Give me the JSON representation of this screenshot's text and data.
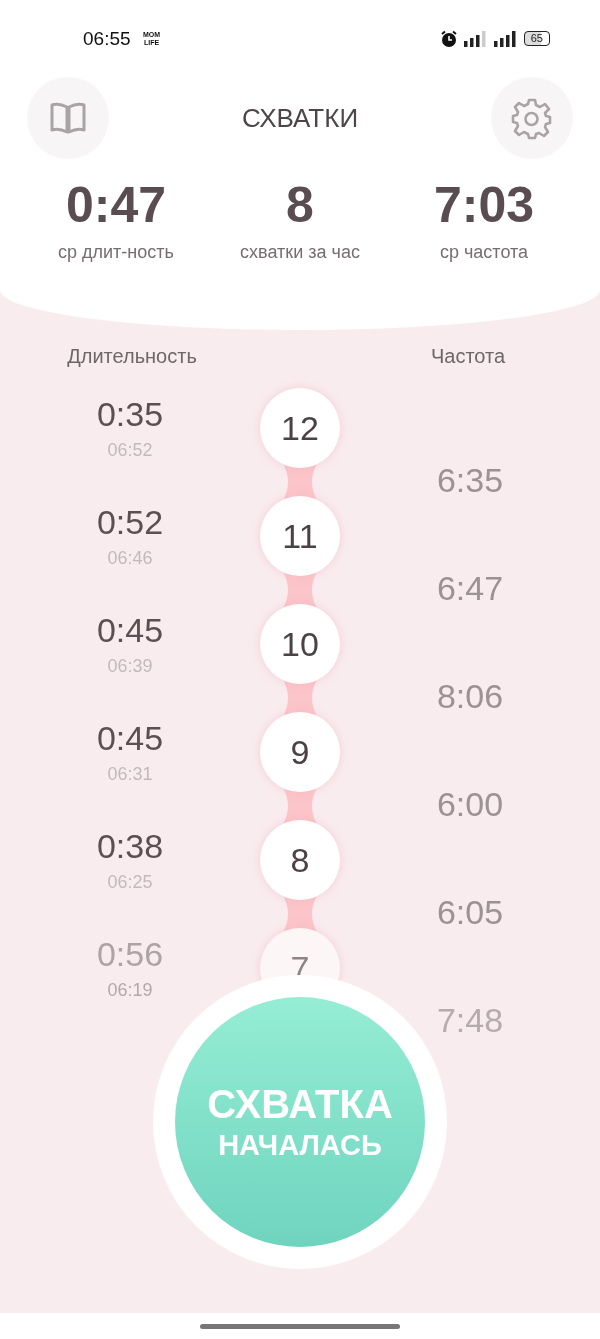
{
  "status_bar": {
    "time": "06:55",
    "app_badge": "MOM LIFE",
    "battery": "65"
  },
  "header": {
    "title": "СХВАТКИ"
  },
  "stats": [
    {
      "value": "0:47",
      "label": "ср длит-ность"
    },
    {
      "value": "8",
      "label": "схватки за час"
    },
    {
      "value": "7:03",
      "label": "ср частота"
    }
  ],
  "columns": {
    "duration": "Длительность",
    "frequency": "Частота"
  },
  "contractions": [
    {
      "number": "12",
      "duration": "0:35",
      "time": "06:52",
      "frequency": "6:35"
    },
    {
      "number": "11",
      "duration": "0:52",
      "time": "06:46",
      "frequency": "6:47"
    },
    {
      "number": "10",
      "duration": "0:45",
      "time": "06:39",
      "frequency": "8:06"
    },
    {
      "number": "9",
      "duration": "0:45",
      "time": "06:31",
      "frequency": "6:00"
    },
    {
      "number": "8",
      "duration": "0:38",
      "time": "06:25",
      "frequency": "6:05"
    },
    {
      "number": "7",
      "duration": "0:56",
      "time": "06:19",
      "frequency": "7:48"
    }
  ],
  "start_button": {
    "lines": [
      "СХВАТКА",
      "НАЧАЛАСЬ"
    ]
  }
}
